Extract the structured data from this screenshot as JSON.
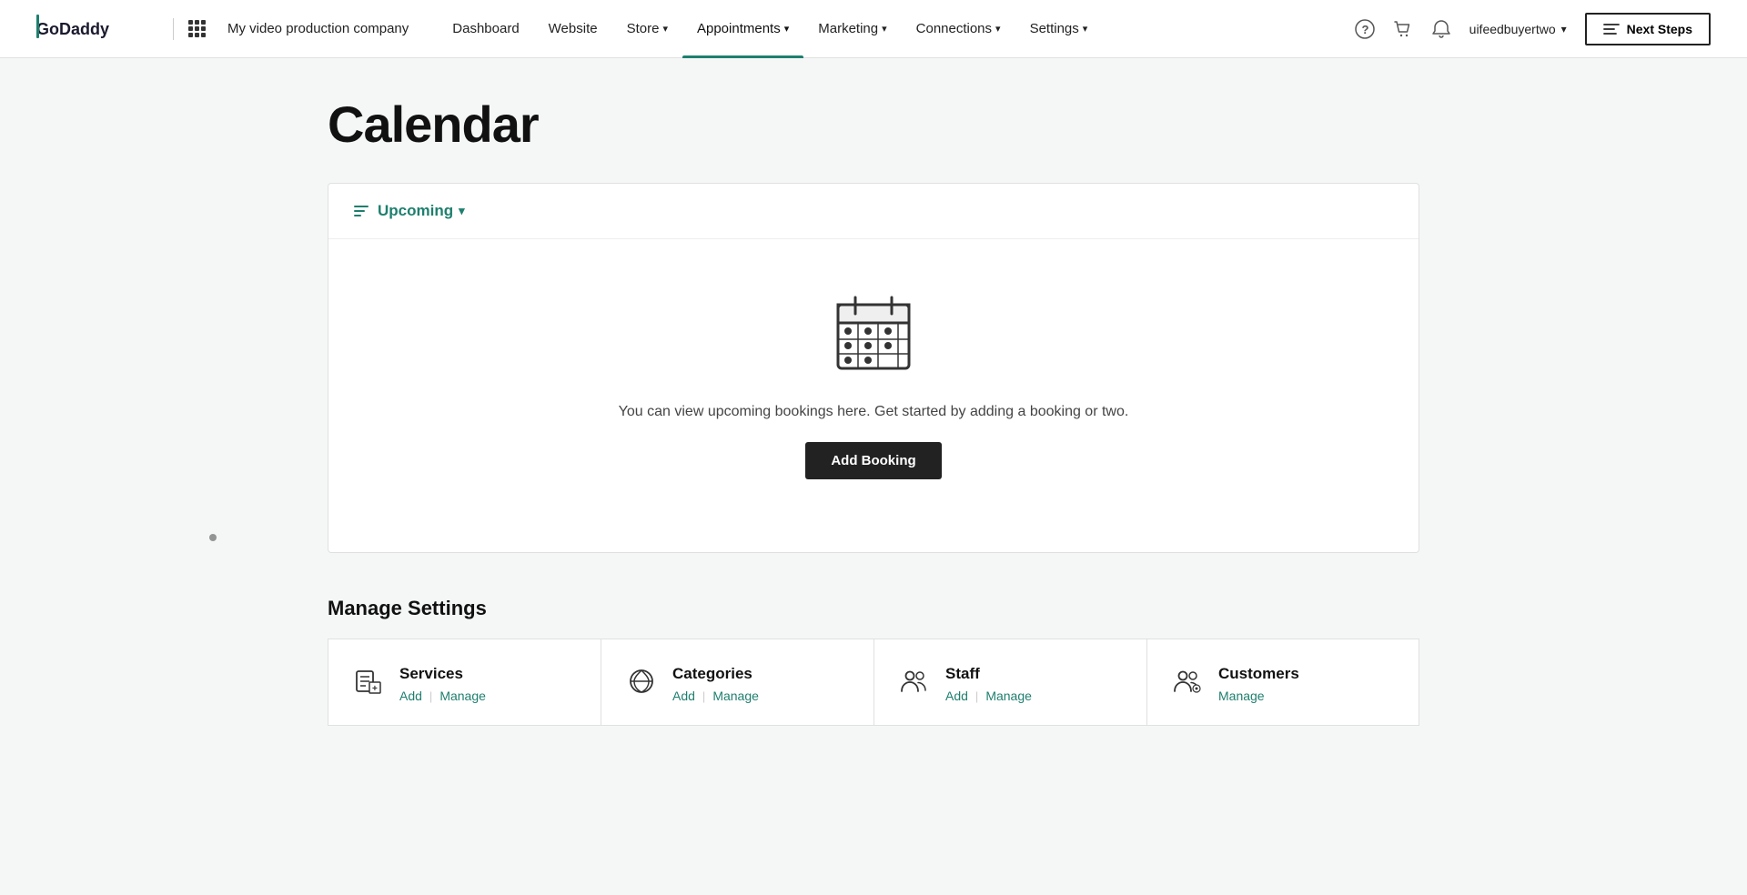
{
  "brand": {
    "logo_alt": "GoDaddy",
    "company_name": "My video production company"
  },
  "header": {
    "help_icon": "?",
    "cart_icon": "🛒",
    "bell_icon": "🔔",
    "user_name": "uifeedbuyertwo",
    "next_steps_label": "Next Steps"
  },
  "nav": {
    "items": [
      {
        "label": "Dashboard",
        "active": false,
        "has_chevron": false
      },
      {
        "label": "Website",
        "active": false,
        "has_chevron": false
      },
      {
        "label": "Store",
        "active": false,
        "has_chevron": true
      },
      {
        "label": "Appointments",
        "active": true,
        "has_chevron": true
      },
      {
        "label": "Marketing",
        "active": false,
        "has_chevron": true
      },
      {
        "label": "Connections",
        "active": false,
        "has_chevron": true
      },
      {
        "label": "Settings",
        "active": false,
        "has_chevron": true
      }
    ]
  },
  "page": {
    "title": "Calendar",
    "upcoming_label": "Upcoming",
    "empty_message": "You can view upcoming bookings here. Get started by adding a booking or two.",
    "add_booking_label": "Add Booking"
  },
  "manage_settings": {
    "title": "Manage Settings",
    "cards": [
      {
        "name": "Services",
        "actions": [
          {
            "label": "Add",
            "type": "add"
          },
          {
            "label": "Manage",
            "type": "manage"
          }
        ]
      },
      {
        "name": "Categories",
        "actions": [
          {
            "label": "Add",
            "type": "add"
          },
          {
            "label": "Manage",
            "type": "manage"
          }
        ]
      },
      {
        "name": "Staff",
        "actions": [
          {
            "label": "Add",
            "type": "add"
          },
          {
            "label": "Manage",
            "type": "manage"
          }
        ]
      },
      {
        "name": "Customers",
        "actions": [
          {
            "label": "Manage",
            "type": "manage"
          }
        ]
      }
    ]
  }
}
